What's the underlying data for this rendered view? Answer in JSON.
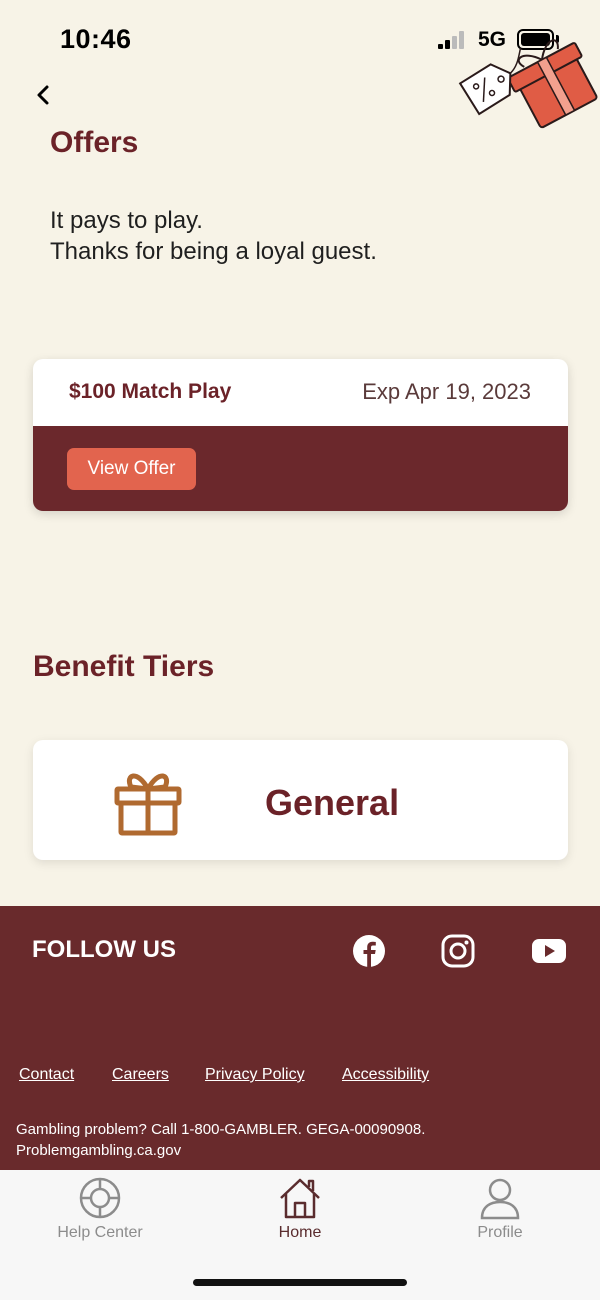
{
  "status_bar": {
    "time": "10:46",
    "network": "5G"
  },
  "page": {
    "title": "Offers",
    "intro_lines": [
      "It pays to play.",
      "Thanks for being a loyal guest."
    ]
  },
  "offer": {
    "name": "$100 Match Play",
    "expiry": "Exp Apr 19, 2023",
    "button_label": "View Offer"
  },
  "benefit_tiers": {
    "title": "Benefit Tiers",
    "tier_name": "General"
  },
  "footer": {
    "follow_title": "FOLLOW US",
    "social_icons": [
      "facebook-icon",
      "instagram-icon",
      "youtube-icon"
    ],
    "links": [
      "Contact",
      "Careers",
      "Privacy Policy",
      "Accessibility"
    ],
    "disclaimer_lines": [
      "Gambling problem? Call 1-800-GAMBLER. GEGA-00090908.",
      "Problemgambling.ca.gov"
    ]
  },
  "tab_bar": {
    "tabs": [
      {
        "label": "Help Center",
        "icon": "lifebuoy-icon",
        "active": false
      },
      {
        "label": "Home",
        "icon": "house-icon",
        "active": true
      },
      {
        "label": "Profile",
        "icon": "person-icon",
        "active": false
      }
    ]
  },
  "colors": {
    "background": "#f7f3e7",
    "brand_maroon": "#6b2228",
    "accent_coral": "#e2644e",
    "tier_icon": "#b06a30"
  }
}
